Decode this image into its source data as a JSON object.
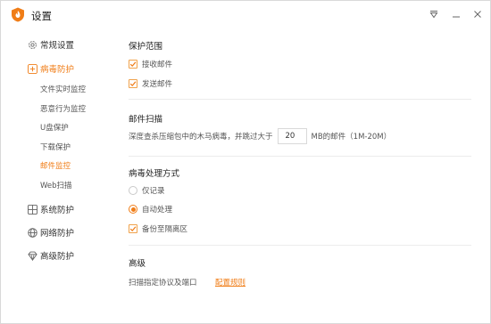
{
  "window": {
    "title": "设置"
  },
  "sidebar": {
    "items": [
      {
        "label": "常规设置",
        "icon": "gear-icon"
      },
      {
        "label": "病毒防护",
        "icon": "shield-plus-icon",
        "active": true
      },
      {
        "label": "系统防护",
        "icon": "system-grid-icon"
      },
      {
        "label": "网络防护",
        "icon": "globe-icon"
      },
      {
        "label": "高级防护",
        "icon": "diamond-icon"
      }
    ],
    "sub_items": [
      {
        "label": "文件实时监控"
      },
      {
        "label": "恶意行为监控"
      },
      {
        "label": "U盘保护"
      },
      {
        "label": "下载保护"
      },
      {
        "label": "邮件监控",
        "active": true
      },
      {
        "label": "Web扫描"
      }
    ]
  },
  "main": {
    "protection_scope": {
      "title": "保护范围",
      "receive_mail": {
        "label": "接收邮件",
        "checked": true
      },
      "send_mail": {
        "label": "发送邮件",
        "checked": true
      }
    },
    "mail_scan": {
      "title": "邮件扫描",
      "text_before": "深度查杀压缩包中的木马病毒，并跳过大于",
      "size_value": "20",
      "text_after": "MB的邮件（1M-20M）"
    },
    "virus_handling": {
      "title": "病毒处理方式",
      "log_only": {
        "label": "仅记录",
        "selected": false
      },
      "auto_handle": {
        "label": "自动处理",
        "selected": true
      },
      "backup": {
        "label": "备份至隔离区",
        "checked": true
      }
    },
    "advanced": {
      "title": "高级",
      "desc": "扫描指定协议及端口",
      "link": "配置规则"
    }
  },
  "colors": {
    "accent": "#f07d17",
    "divider": "#ececec"
  }
}
